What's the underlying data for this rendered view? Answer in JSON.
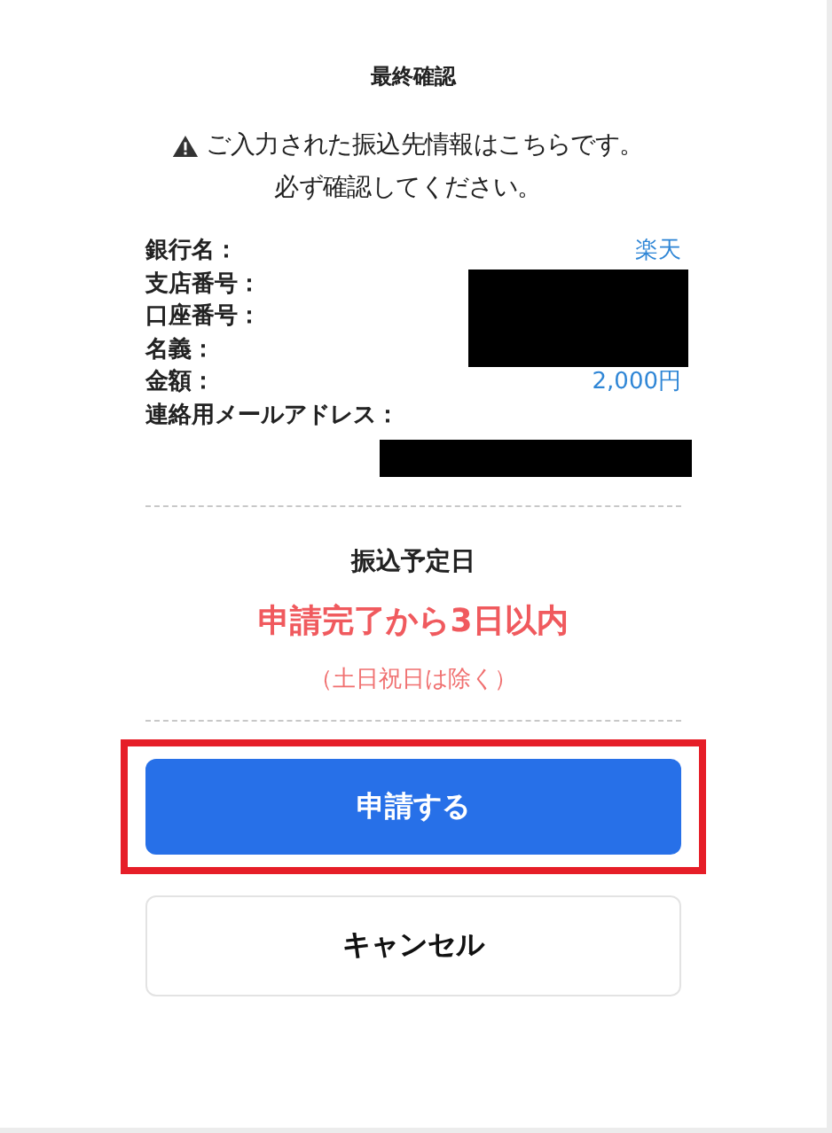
{
  "dialog": {
    "title": "最終確認",
    "notice": {
      "lines": [
        "ご入力された振込先情報はこちらです。",
        "必ず確認してください。"
      ]
    },
    "fields": [
      {
        "label": "銀行名：",
        "kind": "text",
        "value": "楽天"
      },
      {
        "label": "支店番号：",
        "kind": "redacted"
      },
      {
        "label": "口座番号：",
        "kind": "redacted"
      },
      {
        "label": "名義：",
        "kind": "redacted"
      },
      {
        "label": "金額：",
        "kind": "text",
        "value": "2,000円"
      },
      {
        "label": "連絡用メールアドレス：",
        "kind": "redacted_below"
      }
    ],
    "schedule": {
      "heading": "振込予定日",
      "value": "申請完了から3日以内",
      "note": "（土日祝日は除く）"
    },
    "buttons": [
      {
        "label": "申請する",
        "kind": "primary",
        "highlighted": true
      },
      {
        "label": "キャンセル",
        "kind": "secondary",
        "highlighted": false
      }
    ]
  }
}
